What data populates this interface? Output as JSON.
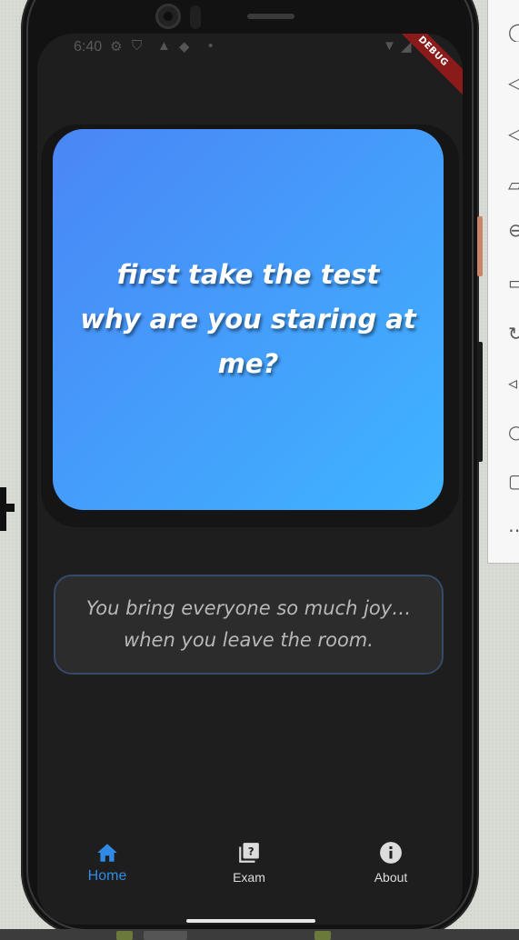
{
  "status_bar": {
    "time": "6:40",
    "debug_label": "DEBUG"
  },
  "card": {
    "line1": "first take the test",
    "line2": "why are you staring at me?"
  },
  "quote": {
    "text": "You bring everyone so much joy… when you leave the room."
  },
  "nav": {
    "items": [
      {
        "label": "Home",
        "icon": "home-icon",
        "active": true
      },
      {
        "label": "Exam",
        "icon": "quiz-icon",
        "active": false
      },
      {
        "label": "About",
        "icon": "info-icon",
        "active": false
      }
    ]
  },
  "colors": {
    "card_gradient_start": "#4a86f6",
    "card_gradient_end": "#3fb4ff",
    "active_nav": "#2f8be6",
    "screen_bg": "#1e1e1e",
    "quote_border": "#354a6b"
  }
}
